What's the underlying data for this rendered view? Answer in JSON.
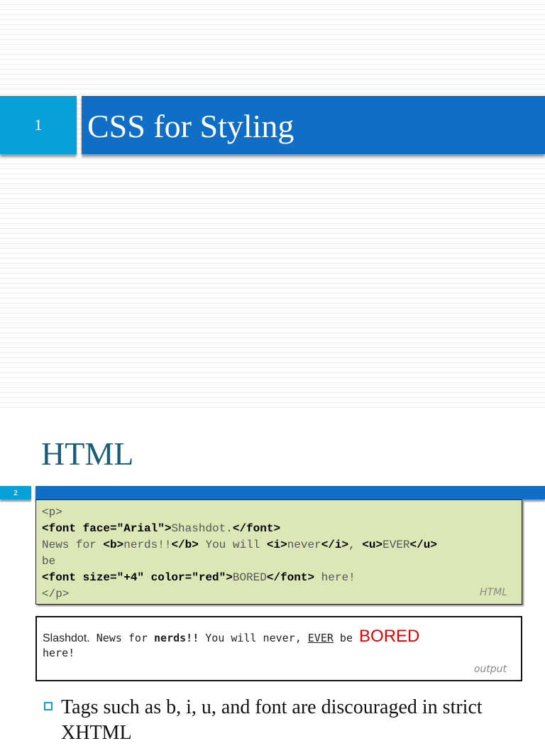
{
  "slide1": {
    "number": "1",
    "title": "CSS for Styling"
  },
  "slide2": {
    "number": "2",
    "title": "HTML",
    "code": {
      "l1": "<p>",
      "l2a": "<font face=\"Arial\">",
      "l2b": "Shashdot.",
      "l2c": "</font>",
      "l3a": "News for ",
      "l3b": "<b>",
      "l3c": "nerds!!",
      "l3d": "</b>",
      "l3e": " You will ",
      "l3f": "<i>",
      "l3g": "never",
      "l3h": "</i>",
      ", ": "",
      "l3i": ", ",
      "l3j": "<u>",
      "l3k": "EVER",
      "l3l": "</u>",
      "l4": "be",
      "l5a": "<font size=\"+4\" color=\"red\">",
      "l5b": "BORED",
      "l5c": "</font>",
      "l5d": " here!",
      "l6": "</p>",
      "label": "HTML"
    },
    "output": {
      "a": "Slashdot.",
      "b": " News for ",
      "c": "nerds!!",
      "d": " You will never, ",
      "e": "EVER",
      "f": " be ",
      "g": "BORED",
      "h": "here!",
      "label": "output"
    },
    "bullets": [
      "Tags such as b, i, u, and font are discouraged in strict XHTML"
    ]
  }
}
